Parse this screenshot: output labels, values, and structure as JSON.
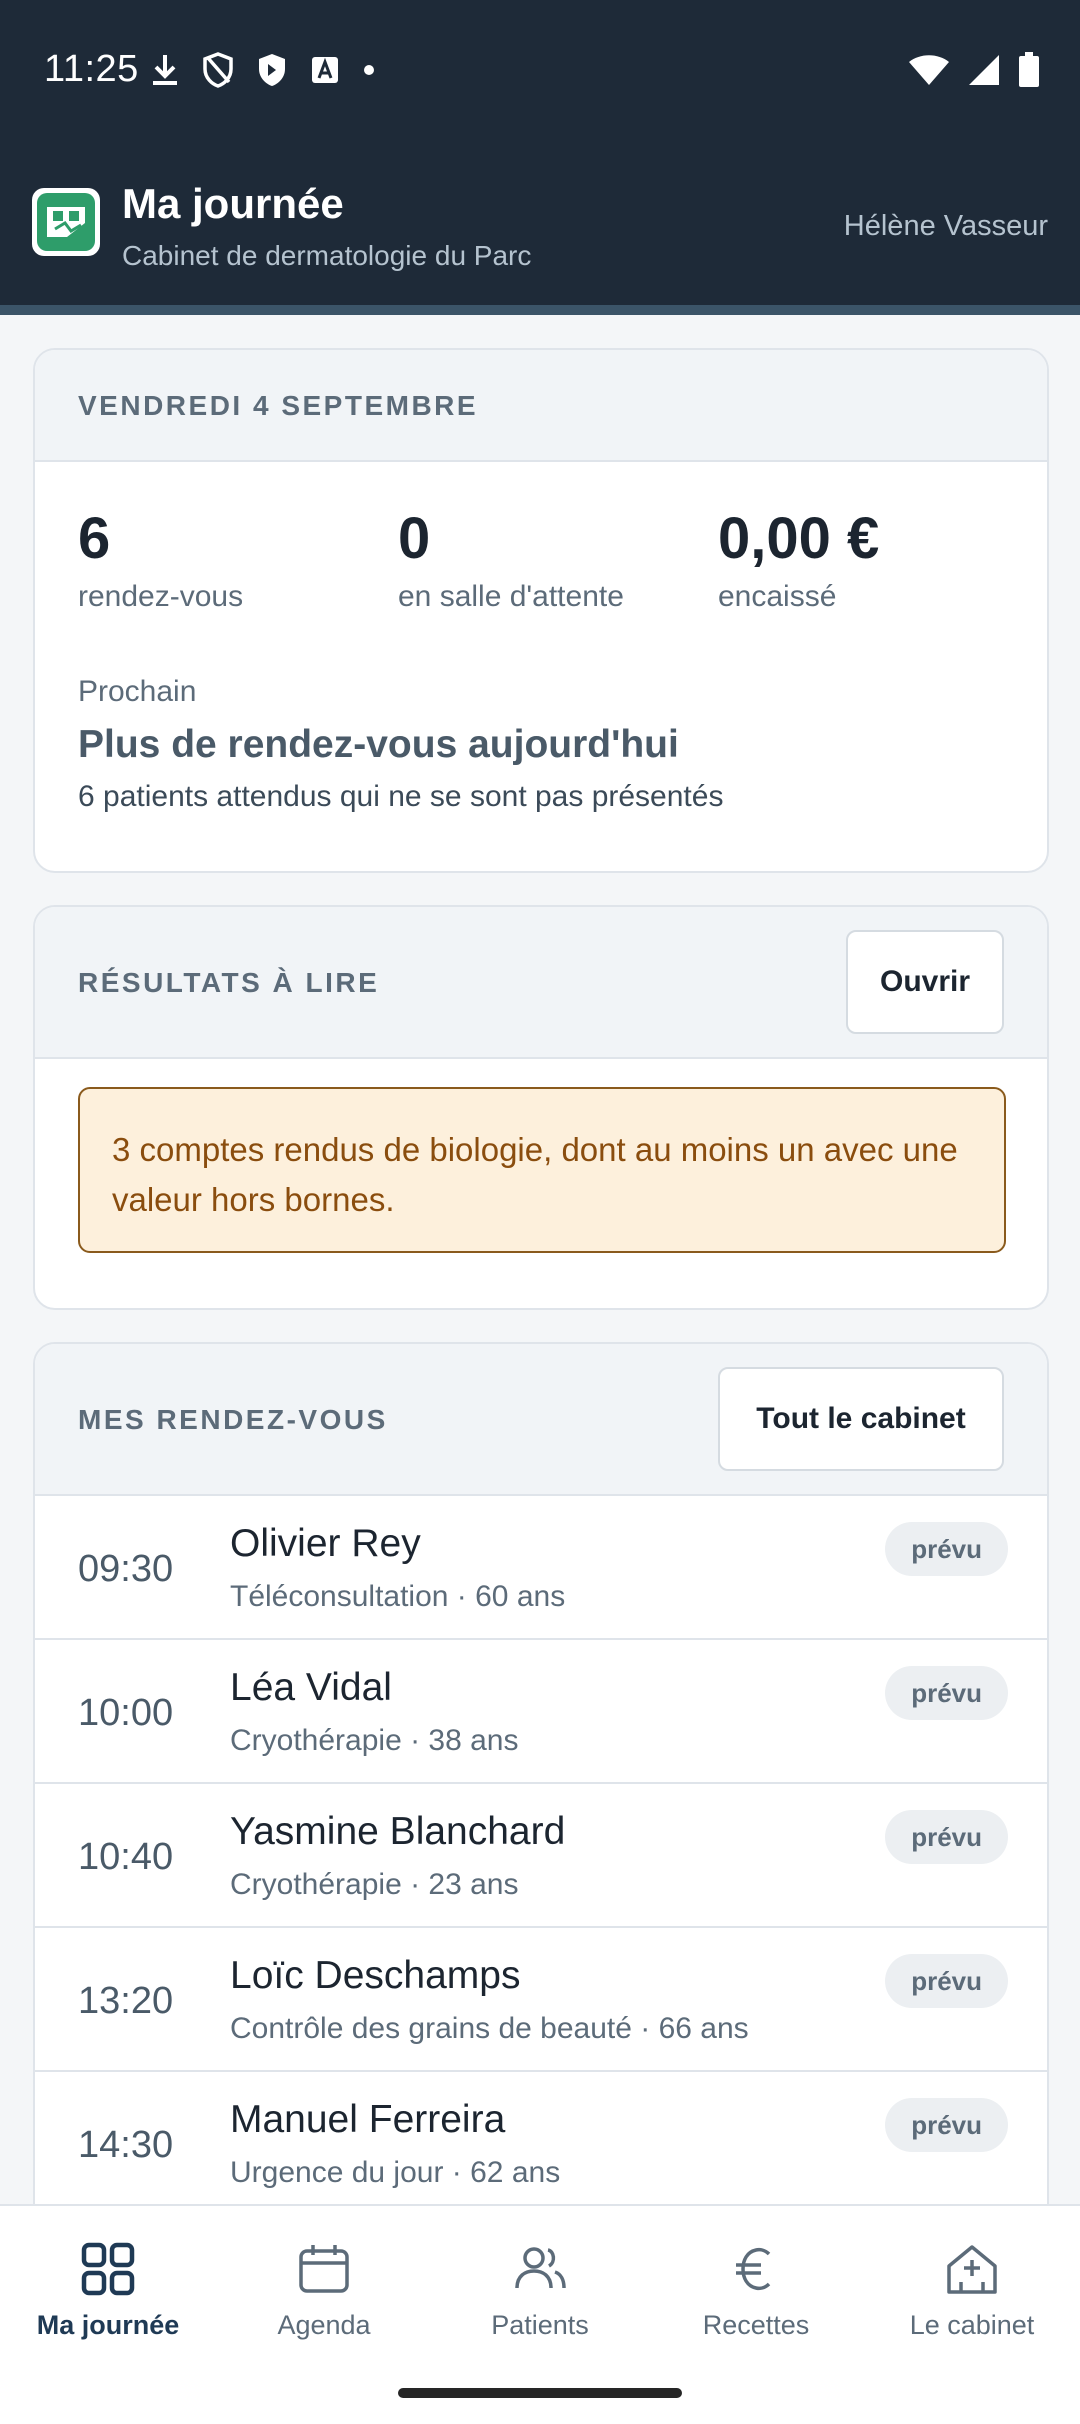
{
  "status_bar": {
    "time": "11:25",
    "icons_left": [
      "download-icon",
      "shield-outline-icon",
      "shield-filled-icon",
      "font-icon",
      "dot-icon"
    ],
    "icons_right": [
      "wifi-icon",
      "signal-icon",
      "battery-icon"
    ]
  },
  "header": {
    "title": "Ma journée",
    "subtitle": "Cabinet de dermatologie du Parc",
    "user": "Hélène Vasseur"
  },
  "summary": {
    "date": "VENDREDI 4 SEPTEMBRE",
    "stats": [
      {
        "value": "6",
        "label": "rendez-vous"
      },
      {
        "value": "0",
        "label": "en salle d'attente"
      },
      {
        "value": "0,00 €",
        "label": "encaissé"
      }
    ],
    "next_label": "Prochain",
    "next_title": "Plus de rendez-vous aujourd'hui",
    "next_sub": "6 patients attendus qui ne se sont pas présentés"
  },
  "results": {
    "title": "RÉSULTATS À LIRE",
    "button": "Ouvrir",
    "alert": "3 comptes rendus de biologie, dont au moins un avec une valeur hors bornes."
  },
  "appointments": {
    "title": "MES RENDEZ-VOUS",
    "button": "Tout le cabinet",
    "items": [
      {
        "time": "09:30",
        "name": "Olivier Rey",
        "detail": "Téléconsultation · 60 ans",
        "status": "prévu"
      },
      {
        "time": "10:00",
        "name": "Léa Vidal",
        "detail": "Cryothérapie · 38 ans",
        "status": "prévu"
      },
      {
        "time": "10:40",
        "name": "Yasmine Blanchard",
        "detail": "Cryothérapie · 23 ans",
        "status": "prévu"
      },
      {
        "time": "13:20",
        "name": "Loïc Deschamps",
        "detail": "Contrôle des grains de beauté · 66 ans",
        "status": "prévu"
      },
      {
        "time": "14:30",
        "name": "Manuel Ferreira",
        "detail": "Urgence du jour · 62 ans",
        "status": "prévu"
      }
    ]
  },
  "nav": {
    "items": [
      {
        "label": "Ma journée",
        "icon": "grid-icon",
        "active": true
      },
      {
        "label": "Agenda",
        "icon": "calendar-icon",
        "active": false
      },
      {
        "label": "Patients",
        "icon": "people-icon",
        "active": false
      },
      {
        "label": "Recettes",
        "icon": "euro-icon",
        "active": false
      },
      {
        "label": "Le cabinet",
        "icon": "building-icon",
        "active": false
      }
    ]
  },
  "colors": {
    "header_bg": "#1e2a38",
    "accent": "#1f3a55",
    "alert_bg": "#fdf0dc",
    "alert_border": "#8a5a1c",
    "logo_green": "#2e9d6a"
  }
}
